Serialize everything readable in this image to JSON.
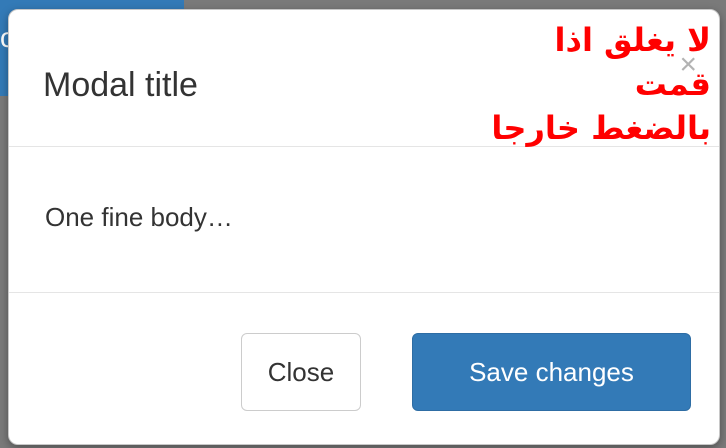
{
  "background": {
    "button_label_fragment": "c"
  },
  "modal": {
    "title": "Modal title",
    "close_icon": "×",
    "body_text": "One fine body…",
    "annotation_line1": "لا يغلق اذا قمت",
    "annotation_line2": "بالضغط خارجا",
    "footer": {
      "close_label": "Close",
      "save_label": "Save changes"
    }
  },
  "colors": {
    "primary": "#337ab7",
    "annotation": "#ff0000",
    "backdrop": "#7a7a7a"
  }
}
